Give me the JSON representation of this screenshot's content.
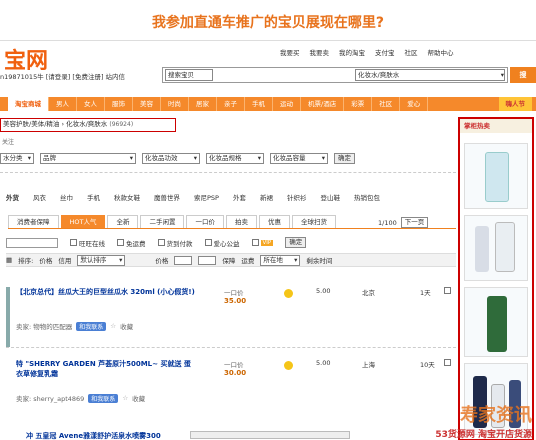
{
  "heading": "我参加直通车推广的宝贝展现在哪里?",
  "site": {
    "logo_text": "宝网",
    "user_line": "n19871015牛 [请登录] [免费注册] 站内信",
    "top_links": [
      "我要买",
      "我要卖",
      "我的淘宝",
      "支付宝",
      "社区",
      "帮助中心"
    ]
  },
  "search": {
    "type_label": "搜索宝贝",
    "category_value": "化妆水/爽肤水",
    "button_label": "搜"
  },
  "nav": {
    "items": [
      "淘宝商城",
      "男人",
      "女人",
      "服饰",
      "美容",
      "时尚",
      "居家",
      "亲子",
      "手机",
      "运动",
      "机票/酒店",
      "彩票",
      "社区",
      "爱心",
      "嗨人节"
    ]
  },
  "breadcrumb": {
    "text": "美容护肤/美体/精油 › 化妆水/爽肤水",
    "count": "(96924)",
    "sub": "关注"
  },
  "filters": {
    "items": [
      "水分类",
      "品牌",
      "化妆品功效",
      "化妆品规格",
      "化妆品容量"
    ],
    "confirm_label": "确定"
  },
  "category_row": [
    "外货",
    "风衣",
    "丝巾",
    "手机",
    "秋款女鞋",
    "魔兽世界",
    "索尼PSP",
    "外套",
    "新裙",
    "针织衫",
    "登山鞋",
    "热销包包"
  ],
  "tabs": {
    "items": [
      "消费者保障",
      "HOT人气",
      "全新",
      "二手闲置",
      "一口价",
      "拍卖",
      "优惠",
      "全球扫货"
    ],
    "active": "HOT人气",
    "pager_text": "1/100",
    "next_label": "下一页"
  },
  "checks": {
    "items": [
      "旺旺在线",
      "免运费",
      "货到付款",
      "爱心公益"
    ],
    "vip_label": "VIP",
    "confirm_label": "确定"
  },
  "sortbar": {
    "sort_label": "排序:",
    "sort_price": "价格",
    "sort_credit": "信用",
    "sort_select": "默认排序",
    "price_label": "价格",
    "guarantee_label": "保障",
    "ship_label": "运费",
    "location_select": "所在地",
    "time_label": "剩余时间"
  },
  "items": [
    {
      "title": "【北京总代】丝瓜大王的巨型丝瓜水 320ml (小心假货!)",
      "price_label": "一口价",
      "price": "35.00",
      "shipping": "5.00",
      "location": "北京",
      "time": "1天",
      "seller": "卖家: 物物的匹配器",
      "contact_label": "和我联系",
      "fav_label": "收藏"
    },
    {
      "title": "特 \"SHERRY GARDEN 芦荟原汁500ML~ 买就送 蛋衣草修复乳霜",
      "price_label": "一口价",
      "price": "30.00",
      "shipping": "5.00",
      "location": "上海",
      "time": "10天",
      "seller": "卖家: sherry_apt4869",
      "contact_label": "和我联系",
      "fav_label": "收藏"
    }
  ],
  "bottom_item": "冲 五皇冠 Avene雅漾舒护活泉水喷雾300",
  "sidebar": {
    "title": "掌柜热卖"
  },
  "watermark": {
    "big": "寿家资讯",
    "small": "53货源网 淘宝开店货源"
  },
  "colors": {
    "brand_orange": "#f5892b",
    "highlight_red": "#cc0000",
    "link_blue": "#003399"
  }
}
